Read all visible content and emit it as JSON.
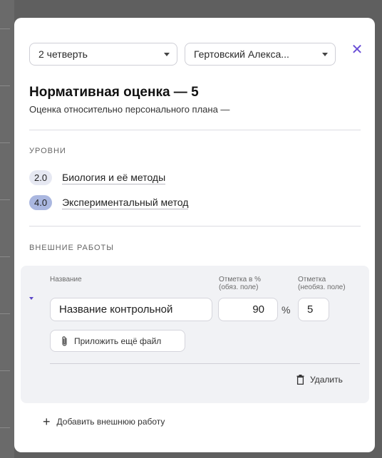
{
  "filters": {
    "quarter": "2 четверть",
    "student": "Гертовский Алекса..."
  },
  "header": {
    "title": "Нормативная оценка — 5",
    "subtitle": "Оценка относительно персонального плана —"
  },
  "levels": {
    "label": "УРОВНИ",
    "items": [
      {
        "value": "2.0",
        "name": "Биология и её методы",
        "color": "#e6e8f2"
      },
      {
        "value": "4.0",
        "name": "Экспериментальный метод",
        "color": "#aab7e0"
      }
    ]
  },
  "external": {
    "label": "ВНЕШНИЕ РАБОТЫ",
    "col_name": "Название",
    "col_percent_1": "Отметка в %",
    "col_percent_2": "(обяз. поле)",
    "col_mark_1": "Отметка",
    "col_mark_2": "(необяз. поле)",
    "work_name": "Название контрольной",
    "percent_value": "90",
    "percent_sign": "%",
    "mark_value": "5",
    "attach_label": "Приложить ещё файл",
    "delete_label": "Удалить",
    "add_label": "Добавить внешнюю работу"
  },
  "colors": {
    "accent": "#6a4fd6",
    "card_bg": "#f1f2f5"
  }
}
